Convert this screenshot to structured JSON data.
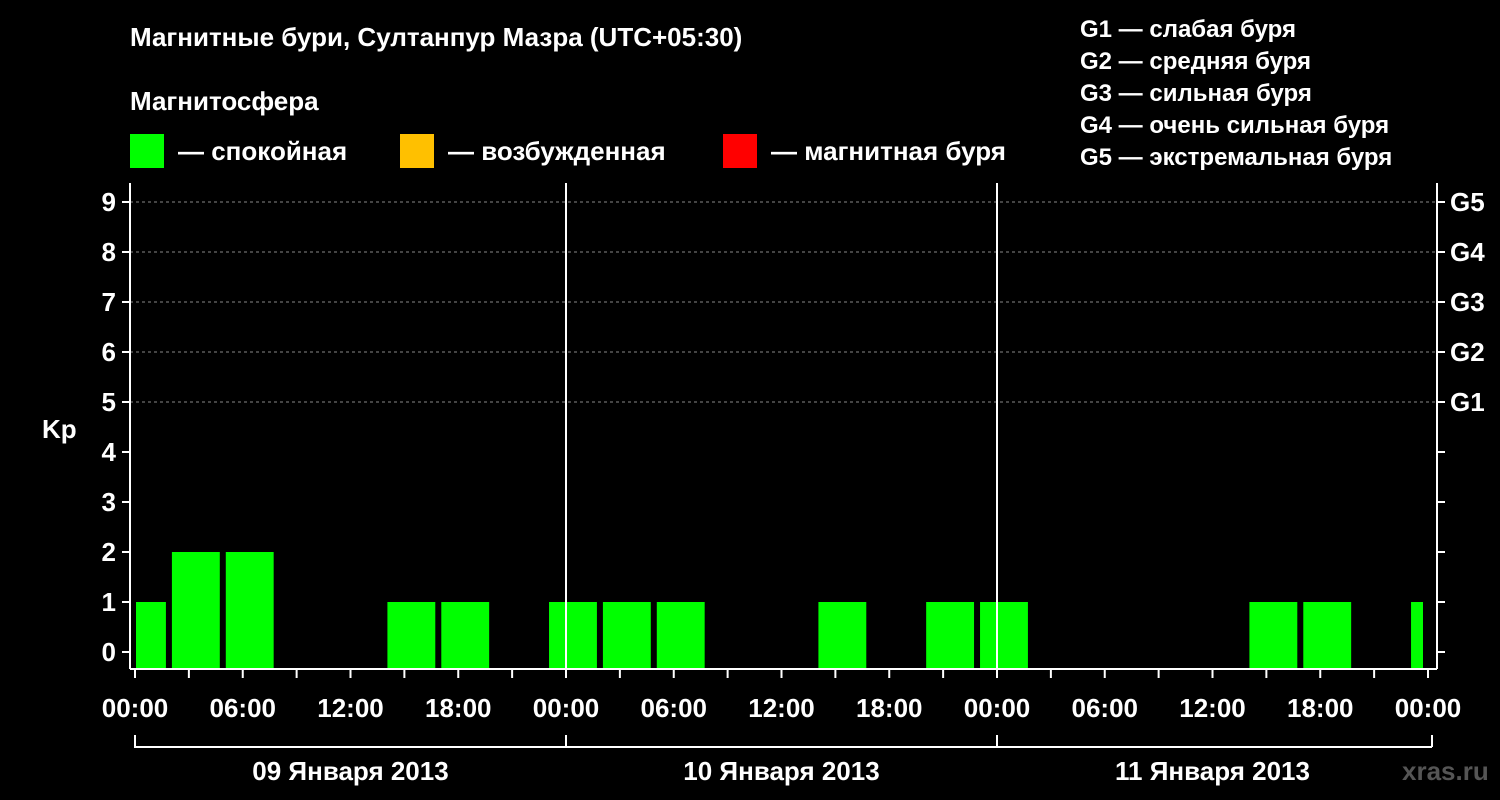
{
  "title": "Магнитные бури, Султанпур Мазра (UTC+05:30)",
  "subtitle": "Магнитосфера",
  "legend": [
    {
      "label": "— спокойная",
      "color": "#00ff00"
    },
    {
      "label": "— возбужденная",
      "color": "#ffc000"
    },
    {
      "label": "— магнитная буря",
      "color": "#ff0000"
    }
  ],
  "g_legend": [
    "G1 — слабая буря",
    "G2 — средняя буря",
    "G3 — сильная буря",
    "G4 — очень сильная буря",
    "G5 — экстремальная буря"
  ],
  "watermark": "xras.ru",
  "chart_data": {
    "type": "bar",
    "ylabel": "Kp",
    "ylim": [
      0,
      9
    ],
    "y_ticks": [
      "0",
      "1",
      "2",
      "3",
      "4",
      "5",
      "6",
      "7",
      "8",
      "9"
    ],
    "right_ticks": [
      {
        "value": 5,
        "label": "G1"
      },
      {
        "value": 6,
        "label": "G2"
      },
      {
        "value": 7,
        "label": "G3"
      },
      {
        "value": 8,
        "label": "G4"
      },
      {
        "value": 9,
        "label": "G5"
      }
    ],
    "x_tick_labels": [
      "00:00",
      "06:00",
      "12:00",
      "18:00",
      "00:00",
      "06:00",
      "12:00",
      "18:00",
      "00:00",
      "06:00",
      "12:00",
      "18:00",
      "00:00"
    ],
    "days": [
      "09 Января 2013",
      "10 Января 2013",
      "11 Января 2013"
    ],
    "grid": true,
    "series": [
      {
        "values": [
          {
            "start_hour": 0,
            "end_hour": 2,
            "kp": 1
          },
          {
            "start_hour": 2,
            "end_hour": 5,
            "kp": 2
          },
          {
            "start_hour": 5,
            "end_hour": 8,
            "kp": 2
          },
          {
            "start_hour": 8,
            "end_hour": 11,
            "kp": 0
          },
          {
            "start_hour": 11,
            "end_hour": 14,
            "kp": 0
          },
          {
            "start_hour": 14,
            "end_hour": 17,
            "kp": 1
          },
          {
            "start_hour": 17,
            "end_hour": 20,
            "kp": 1
          },
          {
            "start_hour": 20,
            "end_hour": 23,
            "kp": 0
          },
          {
            "start_hour": 23,
            "end_hour": 26,
            "kp": 1
          },
          {
            "start_hour": 26,
            "end_hour": 29,
            "kp": 1
          },
          {
            "start_hour": 29,
            "end_hour": 32,
            "kp": 1
          },
          {
            "start_hour": 32,
            "end_hour": 35,
            "kp": 0
          },
          {
            "start_hour": 35,
            "end_hour": 38,
            "kp": 0
          },
          {
            "start_hour": 38,
            "end_hour": 41,
            "kp": 1
          },
          {
            "start_hour": 41,
            "end_hour": 44,
            "kp": 0
          },
          {
            "start_hour": 44,
            "end_hour": 47,
            "kp": 1
          },
          {
            "start_hour": 47,
            "end_hour": 50,
            "kp": 1
          },
          {
            "start_hour": 50,
            "end_hour": 53,
            "kp": 0
          },
          {
            "start_hour": 53,
            "end_hour": 56,
            "kp": 0
          },
          {
            "start_hour": 56,
            "end_hour": 59,
            "kp": 0
          },
          {
            "start_hour": 59,
            "end_hour": 62,
            "kp": 0
          },
          {
            "start_hour": 62,
            "end_hour": 65,
            "kp": 1
          },
          {
            "start_hour": 65,
            "end_hour": 68,
            "kp": 1
          },
          {
            "start_hour": 68,
            "end_hour": 71,
            "kp": 0
          },
          {
            "start_hour": 71,
            "end_hour": 72,
            "kp": 1
          }
        ]
      }
    ]
  }
}
